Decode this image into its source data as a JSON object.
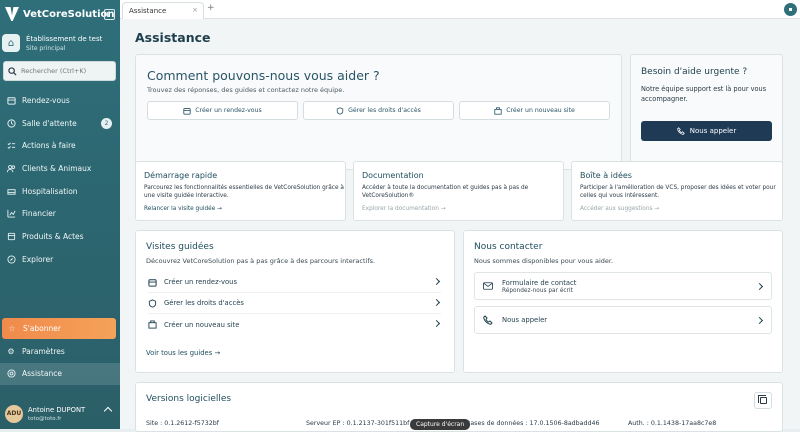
{
  "app": {
    "name": "VetCoreSolution"
  },
  "establishment": {
    "name": "Établissement de test",
    "type": "Site principal"
  },
  "search": {
    "placeholder": "Rechercher (Ctrl+K)"
  },
  "nav": {
    "items": [
      {
        "label": "Rendez-vous",
        "icon": "calendar-icon"
      },
      {
        "label": "Salle d'attente",
        "icon": "clock-icon",
        "badge": "2"
      },
      {
        "label": "Actions à faire",
        "icon": "checklist-icon"
      },
      {
        "label": "Clients & Animaux",
        "icon": "users-icon"
      },
      {
        "label": "Hospitalisation",
        "icon": "hospital-icon"
      },
      {
        "label": "Financier",
        "icon": "chart-icon"
      },
      {
        "label": "Produits & Actes",
        "icon": "box-icon"
      },
      {
        "label": "Explorer",
        "icon": "compass-icon"
      }
    ],
    "subscribe": "S'abonner",
    "settings": "Paramètres",
    "help": "Assistance"
  },
  "user": {
    "initials": "ADU",
    "name": "Antoine DUPONT",
    "email": "toto@toto.fr"
  },
  "tabs": [
    {
      "label": "Assistance",
      "close": "×"
    }
  ],
  "tab_add": "+",
  "page": {
    "title": "Assistance"
  },
  "hero": {
    "title": "Comment pouvons-nous vous aider ?",
    "subtitle": "Trouvez des réponses, des guides et contactez notre équipe.",
    "buttons": [
      {
        "label": "Créer un rendez-vous",
        "icon": "calendar-icon"
      },
      {
        "label": "Gérer les droits d'accès",
        "icon": "shield-icon"
      },
      {
        "label": "Créer un nouveau site",
        "icon": "building-icon"
      }
    ]
  },
  "urgent": {
    "title": "Besoin d'aide urgente ?",
    "text": "Notre équipe support est là pour vous accompagner.",
    "button": "Nous appeler"
  },
  "features": [
    {
      "title": "Démarrage rapide",
      "desc": "Parcourez les fonctionnalités essentielles de VetCoreSolution grâce à une visite guidée interactive.",
      "link": "Relancer la visite guidée",
      "muted": false
    },
    {
      "title": "Documentation",
      "desc": "Accéder à toute la documentation et guides pas à pas de VetCoreSolution®",
      "link": "Explorer la documentation",
      "muted": true
    },
    {
      "title": "Boîte à idées",
      "desc": "Participer à l'amélioration de VCS, proposer des idées et voter pour celles qui vous intéressent.",
      "link": "Accéder aux suggestions",
      "muted": true
    }
  ],
  "guided": {
    "title": "Visites guidées",
    "subtitle": "Découvrez VetCoreSolution pas à pas grâce à des parcours interactifs.",
    "items": [
      {
        "label": "Créer un rendez-vous",
        "icon": "calendar-icon"
      },
      {
        "label": "Gérer les droits d'accès",
        "icon": "shield-icon"
      },
      {
        "label": "Créer un nouveau site",
        "icon": "building-icon"
      }
    ],
    "link": "Voir tous les guides"
  },
  "contact": {
    "title": "Nous contacter",
    "subtitle": "Nous sommes disponibles pour vous aider.",
    "items": [
      {
        "label": "Formulaire de contact",
        "sub": "Répondez-nous par écrit",
        "icon": "mail-icon"
      },
      {
        "label": "Nous appeler",
        "sub": "",
        "icon": "phone-icon"
      }
    ]
  },
  "versions": {
    "title": "Versions logicielles",
    "items": [
      {
        "label": "Site :",
        "value": "0.1.2612-f5732bf"
      },
      {
        "label": "Serveur EP :",
        "value": "0.1.2137-301f511bf"
      },
      {
        "label": "Bases de données :",
        "value": "17.0.1506-8adbadd46"
      },
      {
        "label": "Auth. :",
        "value": "0.1.1438-17aa8c7e8"
      }
    ]
  },
  "tooltip": "Capture d'écran",
  "colors": {
    "sidebar": "#2f6f7a",
    "accent": "#f08a4b",
    "primary_dark": "#1f3a55"
  }
}
